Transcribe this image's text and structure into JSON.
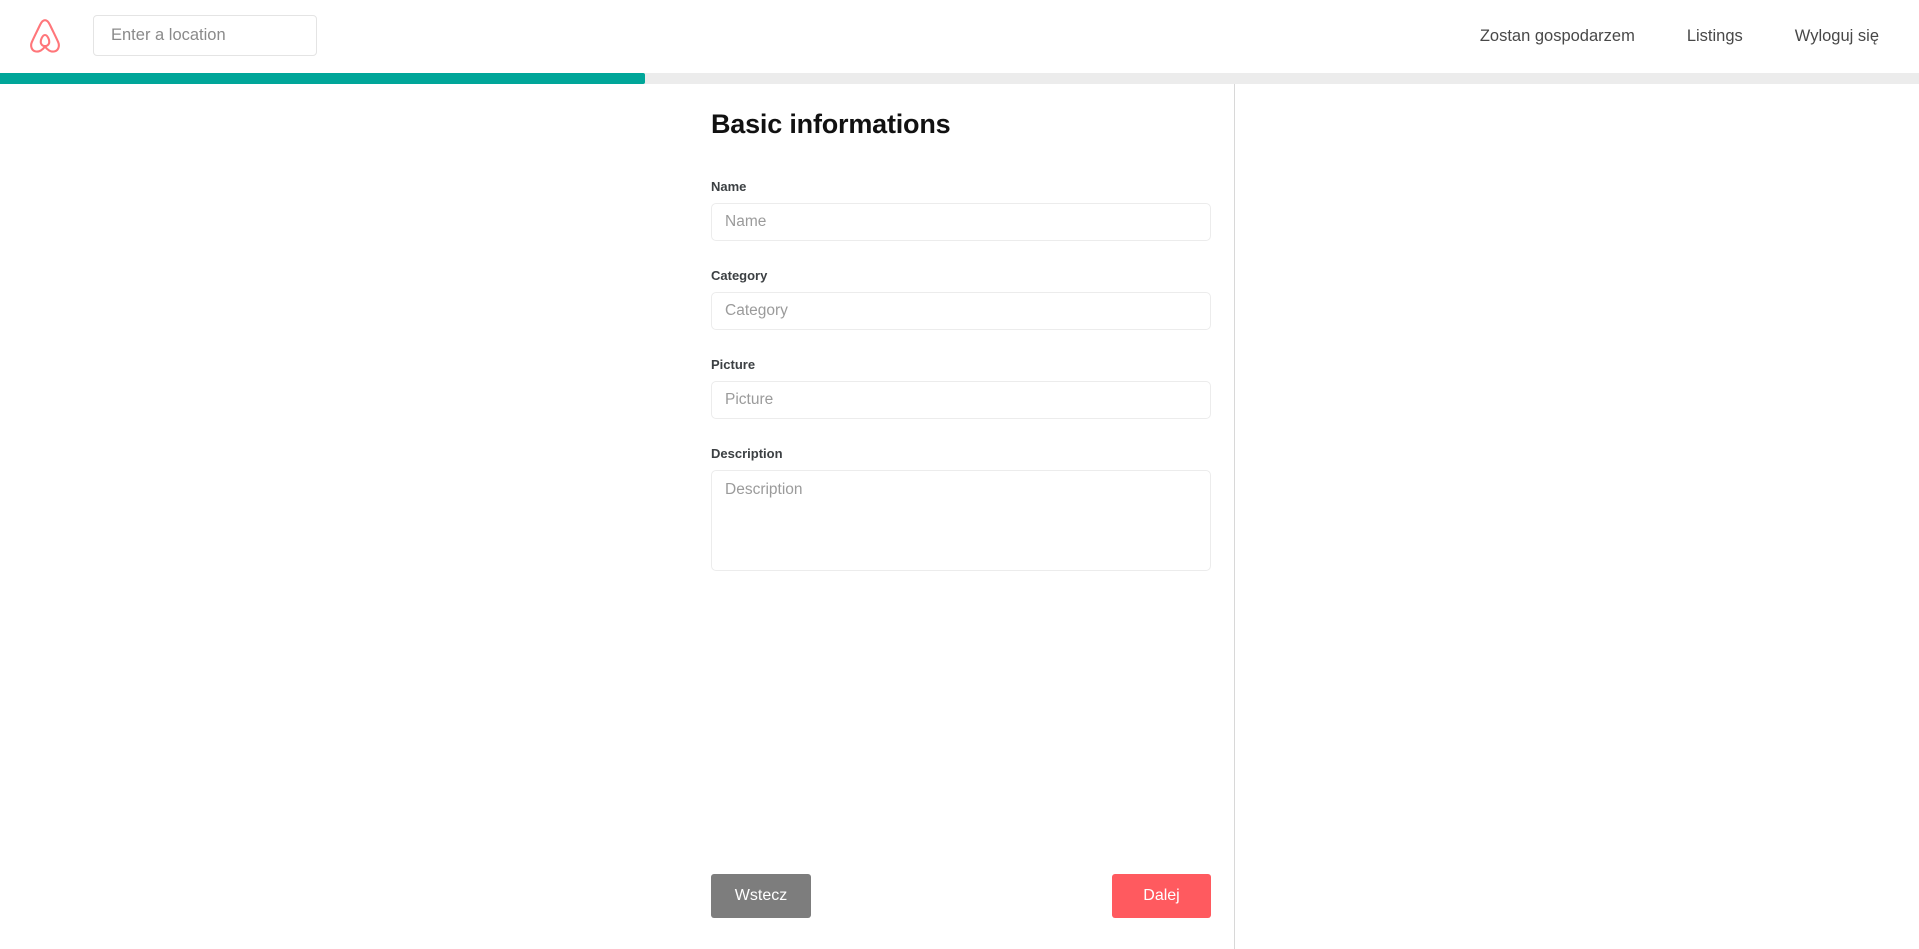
{
  "header": {
    "logo_icon": "airbnb-belo-logo",
    "logo_color": "#ff5a5f",
    "search": {
      "placeholder": "Enter a location",
      "value": ""
    },
    "nav": [
      {
        "label": "Zostan gospodarzem",
        "name": "become-host"
      },
      {
        "label": "Listings",
        "name": "listings"
      },
      {
        "label": "Wyloguj się",
        "name": "logout"
      }
    ]
  },
  "progress": {
    "percent": 33.6,
    "fill_color": "#00a699",
    "track_color": "#ececec"
  },
  "main": {
    "title": "Basic informations",
    "fields": [
      {
        "name": "name",
        "label": "Name",
        "placeholder": "Name",
        "value": "",
        "type": "text"
      },
      {
        "name": "category",
        "label": "Category",
        "placeholder": "Category",
        "value": "",
        "type": "text"
      },
      {
        "name": "picture",
        "label": "Picture",
        "placeholder": "Picture",
        "value": "",
        "type": "text"
      },
      {
        "name": "description",
        "label": "Description",
        "placeholder": "Description",
        "value": "",
        "type": "textarea"
      }
    ]
  },
  "footer": {
    "back_label": "Wstecz",
    "back_color": "#7d7d7d",
    "next_label": "Dalej",
    "next_color": "#ff5a5f"
  }
}
